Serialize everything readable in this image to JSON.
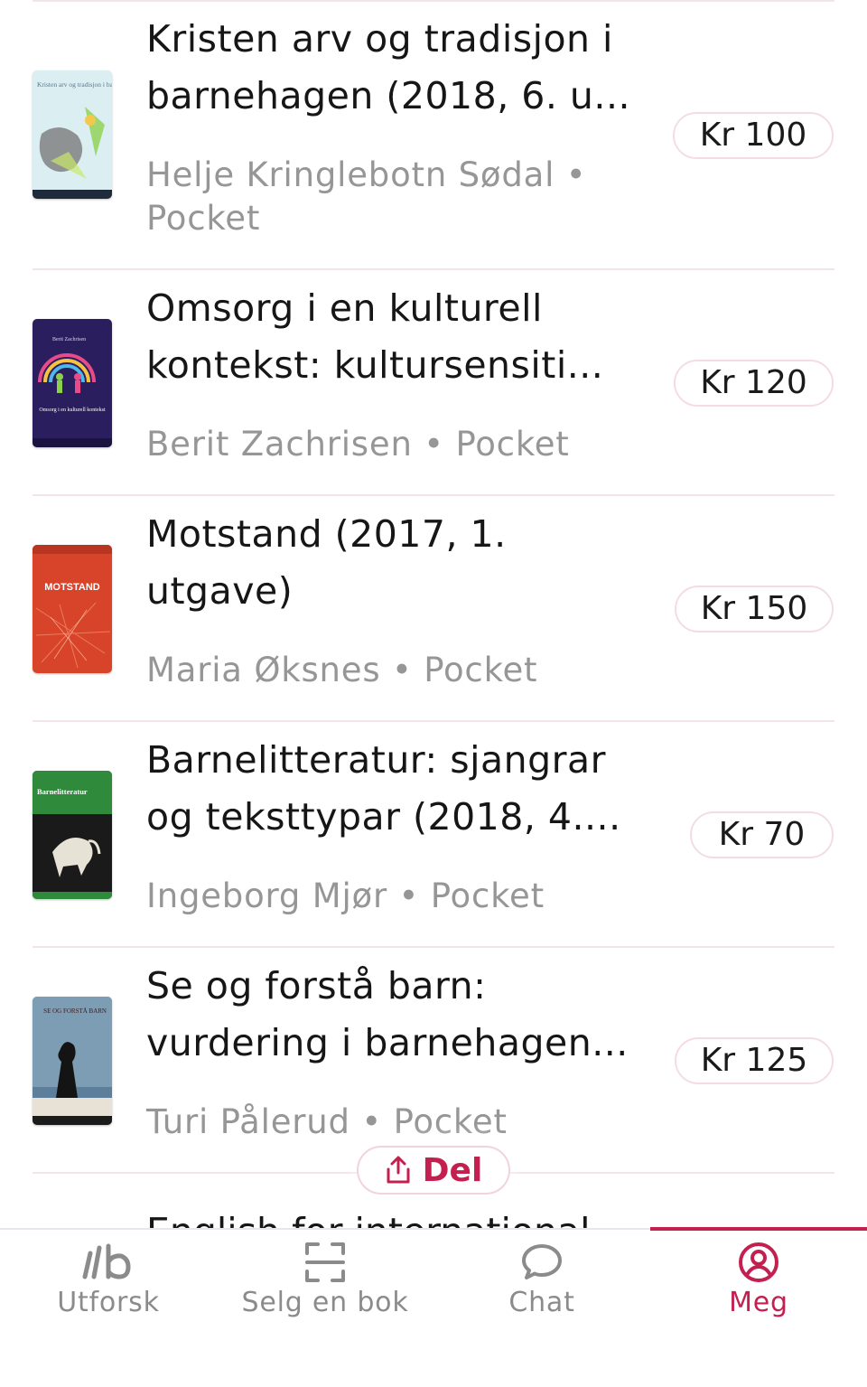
{
  "listings": [
    {
      "title": "Kristen arv og tradisjon i barnehagen (2018, 6. u...",
      "author": "Helje Kringlebotn Sødal",
      "format": "Pocket",
      "price": "Kr 100",
      "cover": {
        "top_text": "Kristen arv og tradisjon i barnehagen",
        "bg": "#cfe3ea"
      }
    },
    {
      "title": "Omsorg i en kulturell kontekst: kultursensiti...",
      "author": "Berit Zachrisen",
      "format": "Pocket",
      "price": "Kr 120",
      "cover": {
        "top_text": "Berit Zachrisen",
        "mid_text": "Omsorg i en kulturell kontekst",
        "bg": "#2b1f5c"
      }
    },
    {
      "title": "Motstand (2017, 1. utgave)",
      "author": "Maria Øksnes",
      "format": "Pocket",
      "price": "Kr 150",
      "cover": {
        "top_text": "MOTSTAND",
        "bg": "#d9472c"
      }
    },
    {
      "title": "Barnelitteratur: sjangrar og teksttypar (2018, 4....",
      "author": "Ingeborg Mjør",
      "format": "Pocket",
      "price": "Kr 70",
      "cover": {
        "top_text": "Barnelitteratur",
        "bg": "#2e8a3b"
      }
    },
    {
      "title": "Se og forstå barn: vurdering i barnehagen...",
      "author": "Turi Pålerud",
      "format": "Pocket",
      "price": "Kr 125",
      "cover": {
        "top_text": "SE OG FORSTÅ BARN",
        "bg": "#4a6f8f"
      }
    }
  ],
  "partial_title": "English for international",
  "share": {
    "label": "Del"
  },
  "nav": [
    {
      "label": "Utforsk",
      "icon": "explore-icon"
    },
    {
      "label": "Selg en bok",
      "icon": "scan-icon"
    },
    {
      "label": "Chat",
      "icon": "chat-icon"
    },
    {
      "label": "Meg",
      "icon": "profile-icon",
      "active": true
    }
  ],
  "colors": {
    "accent": "#c4204f",
    "muted": "#969696",
    "divider": "#f4e4e9"
  }
}
